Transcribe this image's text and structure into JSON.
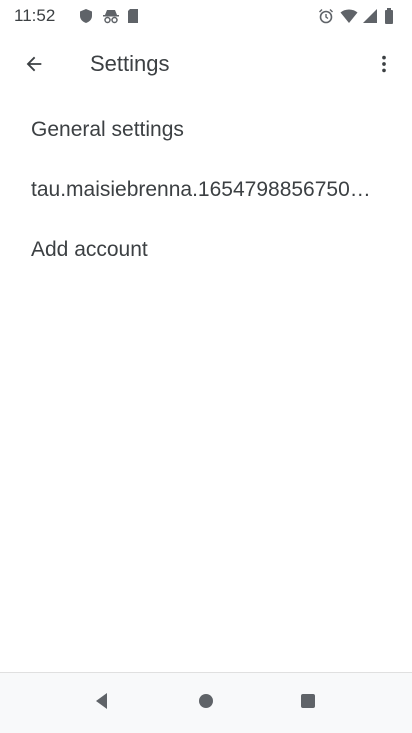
{
  "status_bar": {
    "time": "11:52",
    "left_icons": [
      "shield-icon",
      "incognito-icon",
      "sim-card-icon"
    ],
    "right_icons": [
      "alarm-icon",
      "wifi-icon",
      "signal-icon",
      "battery-icon"
    ]
  },
  "app_bar": {
    "title": "Settings",
    "back_icon": "arrow-back-icon",
    "overflow_icon": "more-vert-icon"
  },
  "settings_list": [
    {
      "label": "General settings"
    },
    {
      "label": "tau.maisiebrenna.1654798856750…"
    },
    {
      "label": "Add account"
    }
  ],
  "nav_bar": {
    "buttons": [
      "back-triangle-icon",
      "home-circle-icon",
      "recents-square-icon"
    ]
  },
  "colors": {
    "icon": "#5f6368",
    "text": "#3c4043",
    "background": "#ffffff"
  }
}
